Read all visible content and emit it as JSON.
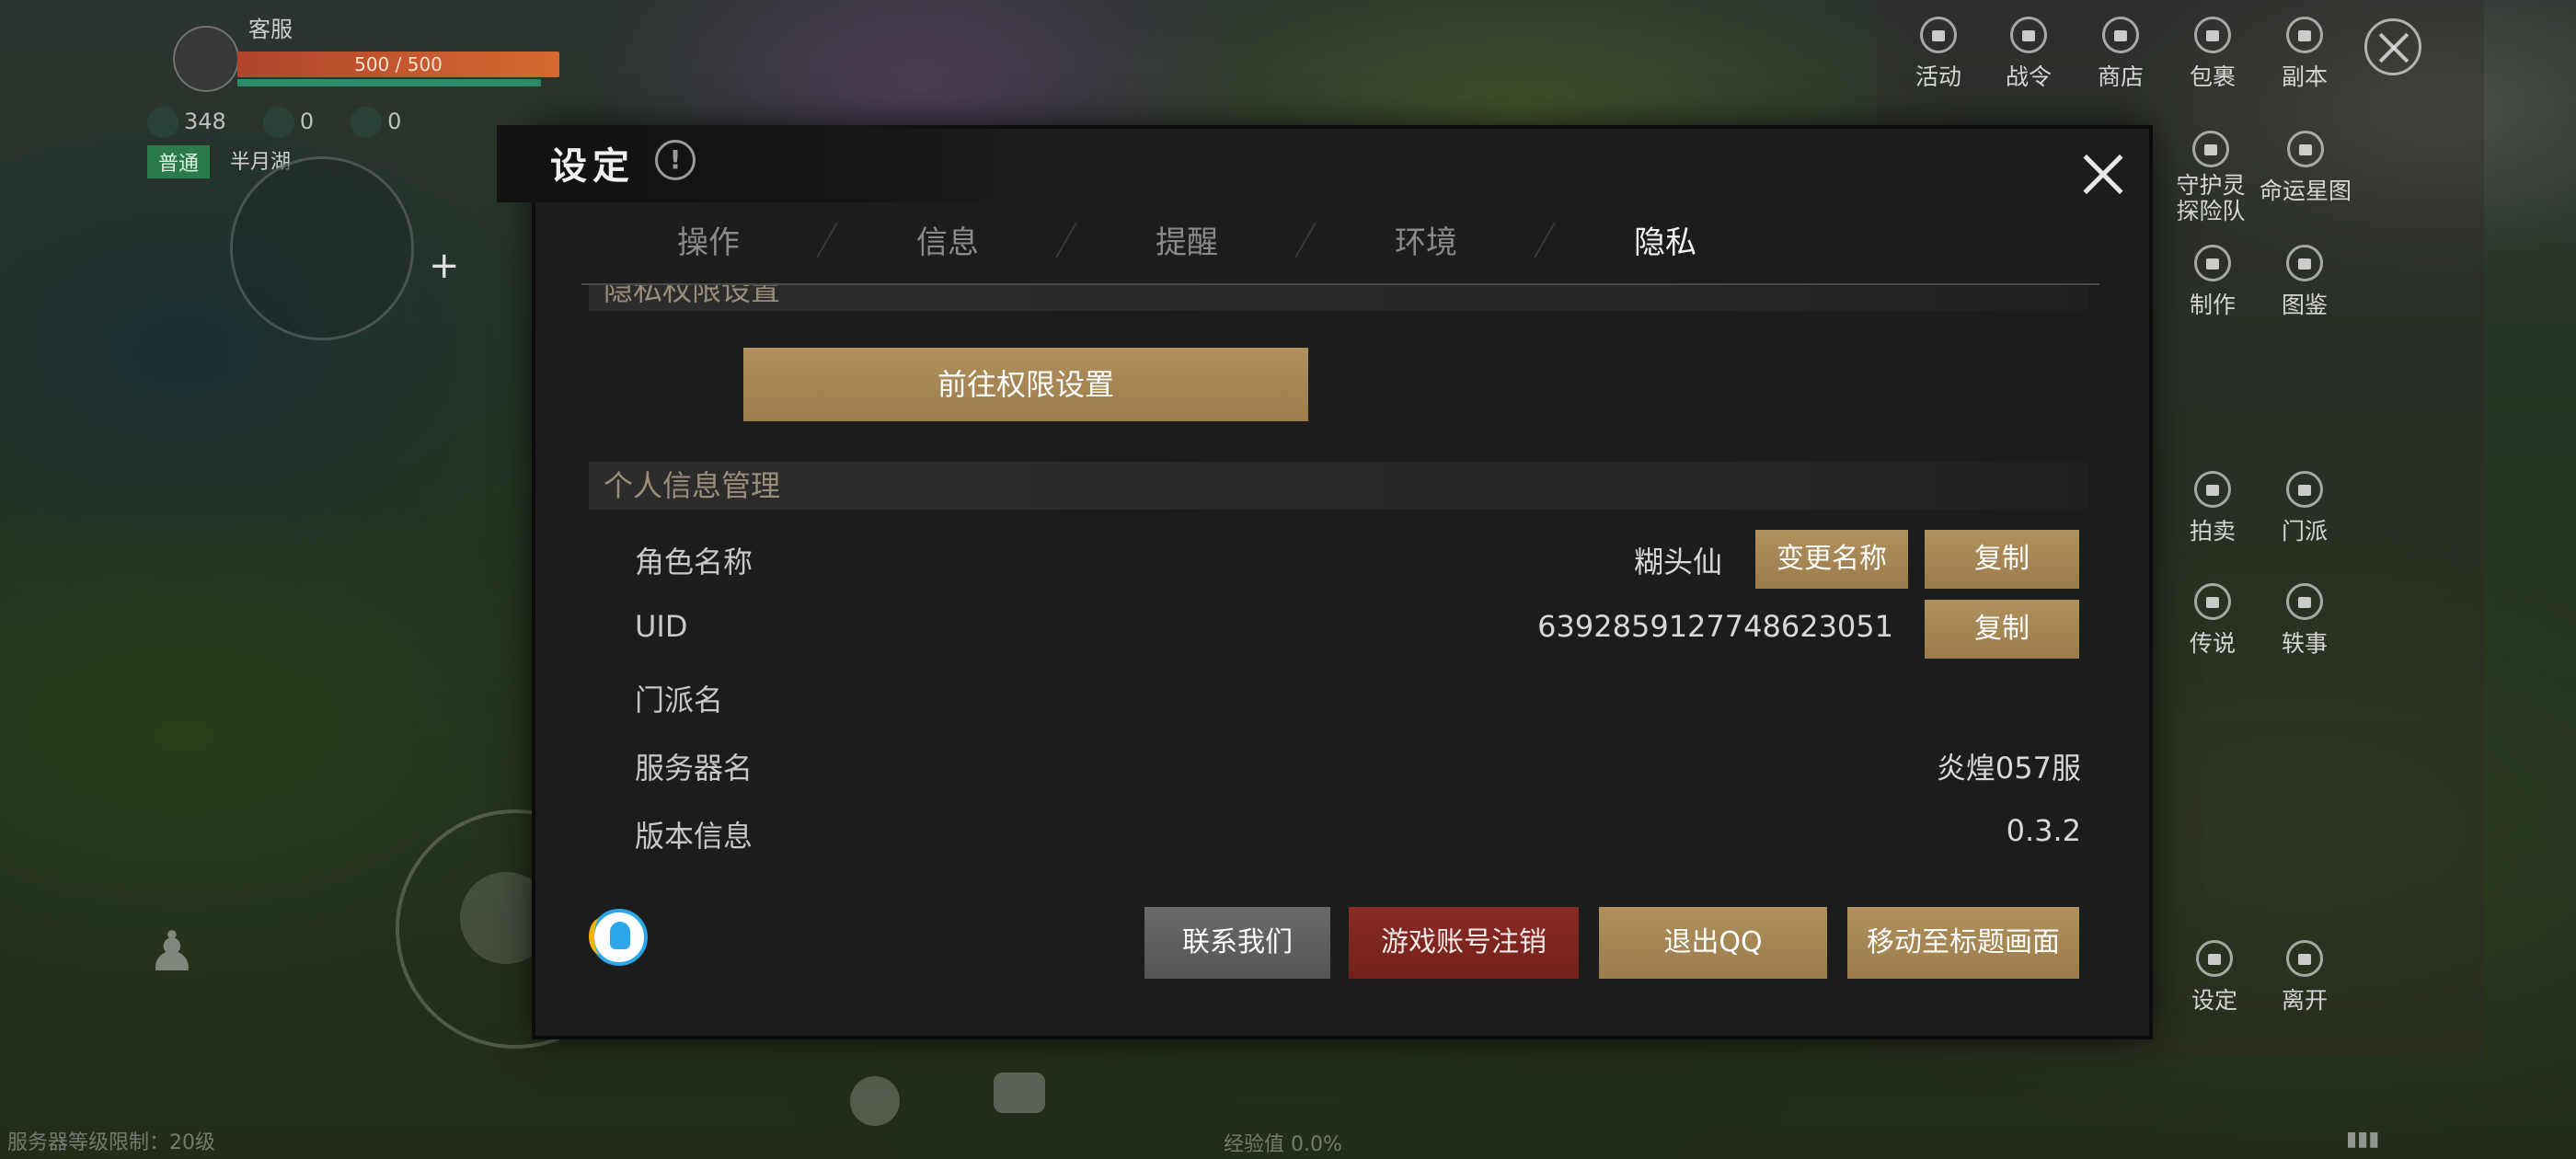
{
  "hud": {
    "service_label": "客服",
    "hp_text": "500 / 500",
    "stats": [
      "348",
      "0",
      "0"
    ],
    "mode": "普通",
    "location": "半月湖",
    "level_limit": "服务器等级限制：20级",
    "exp": "经验值 0.0%"
  },
  "right_menu": {
    "items": [
      "活动",
      "战令",
      "商店",
      "包裹",
      "副本",
      "守护灵探险队",
      "命运星图",
      "制作",
      "图鉴",
      "拍卖",
      "门派",
      "传说",
      "轶事",
      "设定",
      "离开"
    ]
  },
  "modal": {
    "title": "设定",
    "tabs": [
      "操作",
      "信息",
      "提醒",
      "环境",
      "隐私"
    ],
    "active_tab": "隐私",
    "section_privacy": "隐私权限设置",
    "goto_permission_button": "前往权限设置",
    "section_personal": "个人信息管理",
    "rows": {
      "role_name_label": "角色名称",
      "role_name_value": "糊头仙",
      "rename_button": "变更名称",
      "copy_button": "复制",
      "uid_label": "UID",
      "uid_value": "6392859127748623051",
      "sect_label": "门派名",
      "server_label": "服务器名",
      "server_value": "炎煌057服",
      "version_label": "版本信息",
      "version_value": "0.3.2"
    },
    "footer": {
      "contact": "联系我们",
      "cancel_account": "游戏账号注销",
      "quit_qq": "退出QQ",
      "title_screen": "移动至标题画面"
    }
  },
  "colors": {
    "gold_button": "#a88a56",
    "red_button": "#7c241e",
    "grey_button": "#5f5f5f",
    "modal_bg": "#1c1c1c",
    "section_text": "#9a8e7a"
  }
}
